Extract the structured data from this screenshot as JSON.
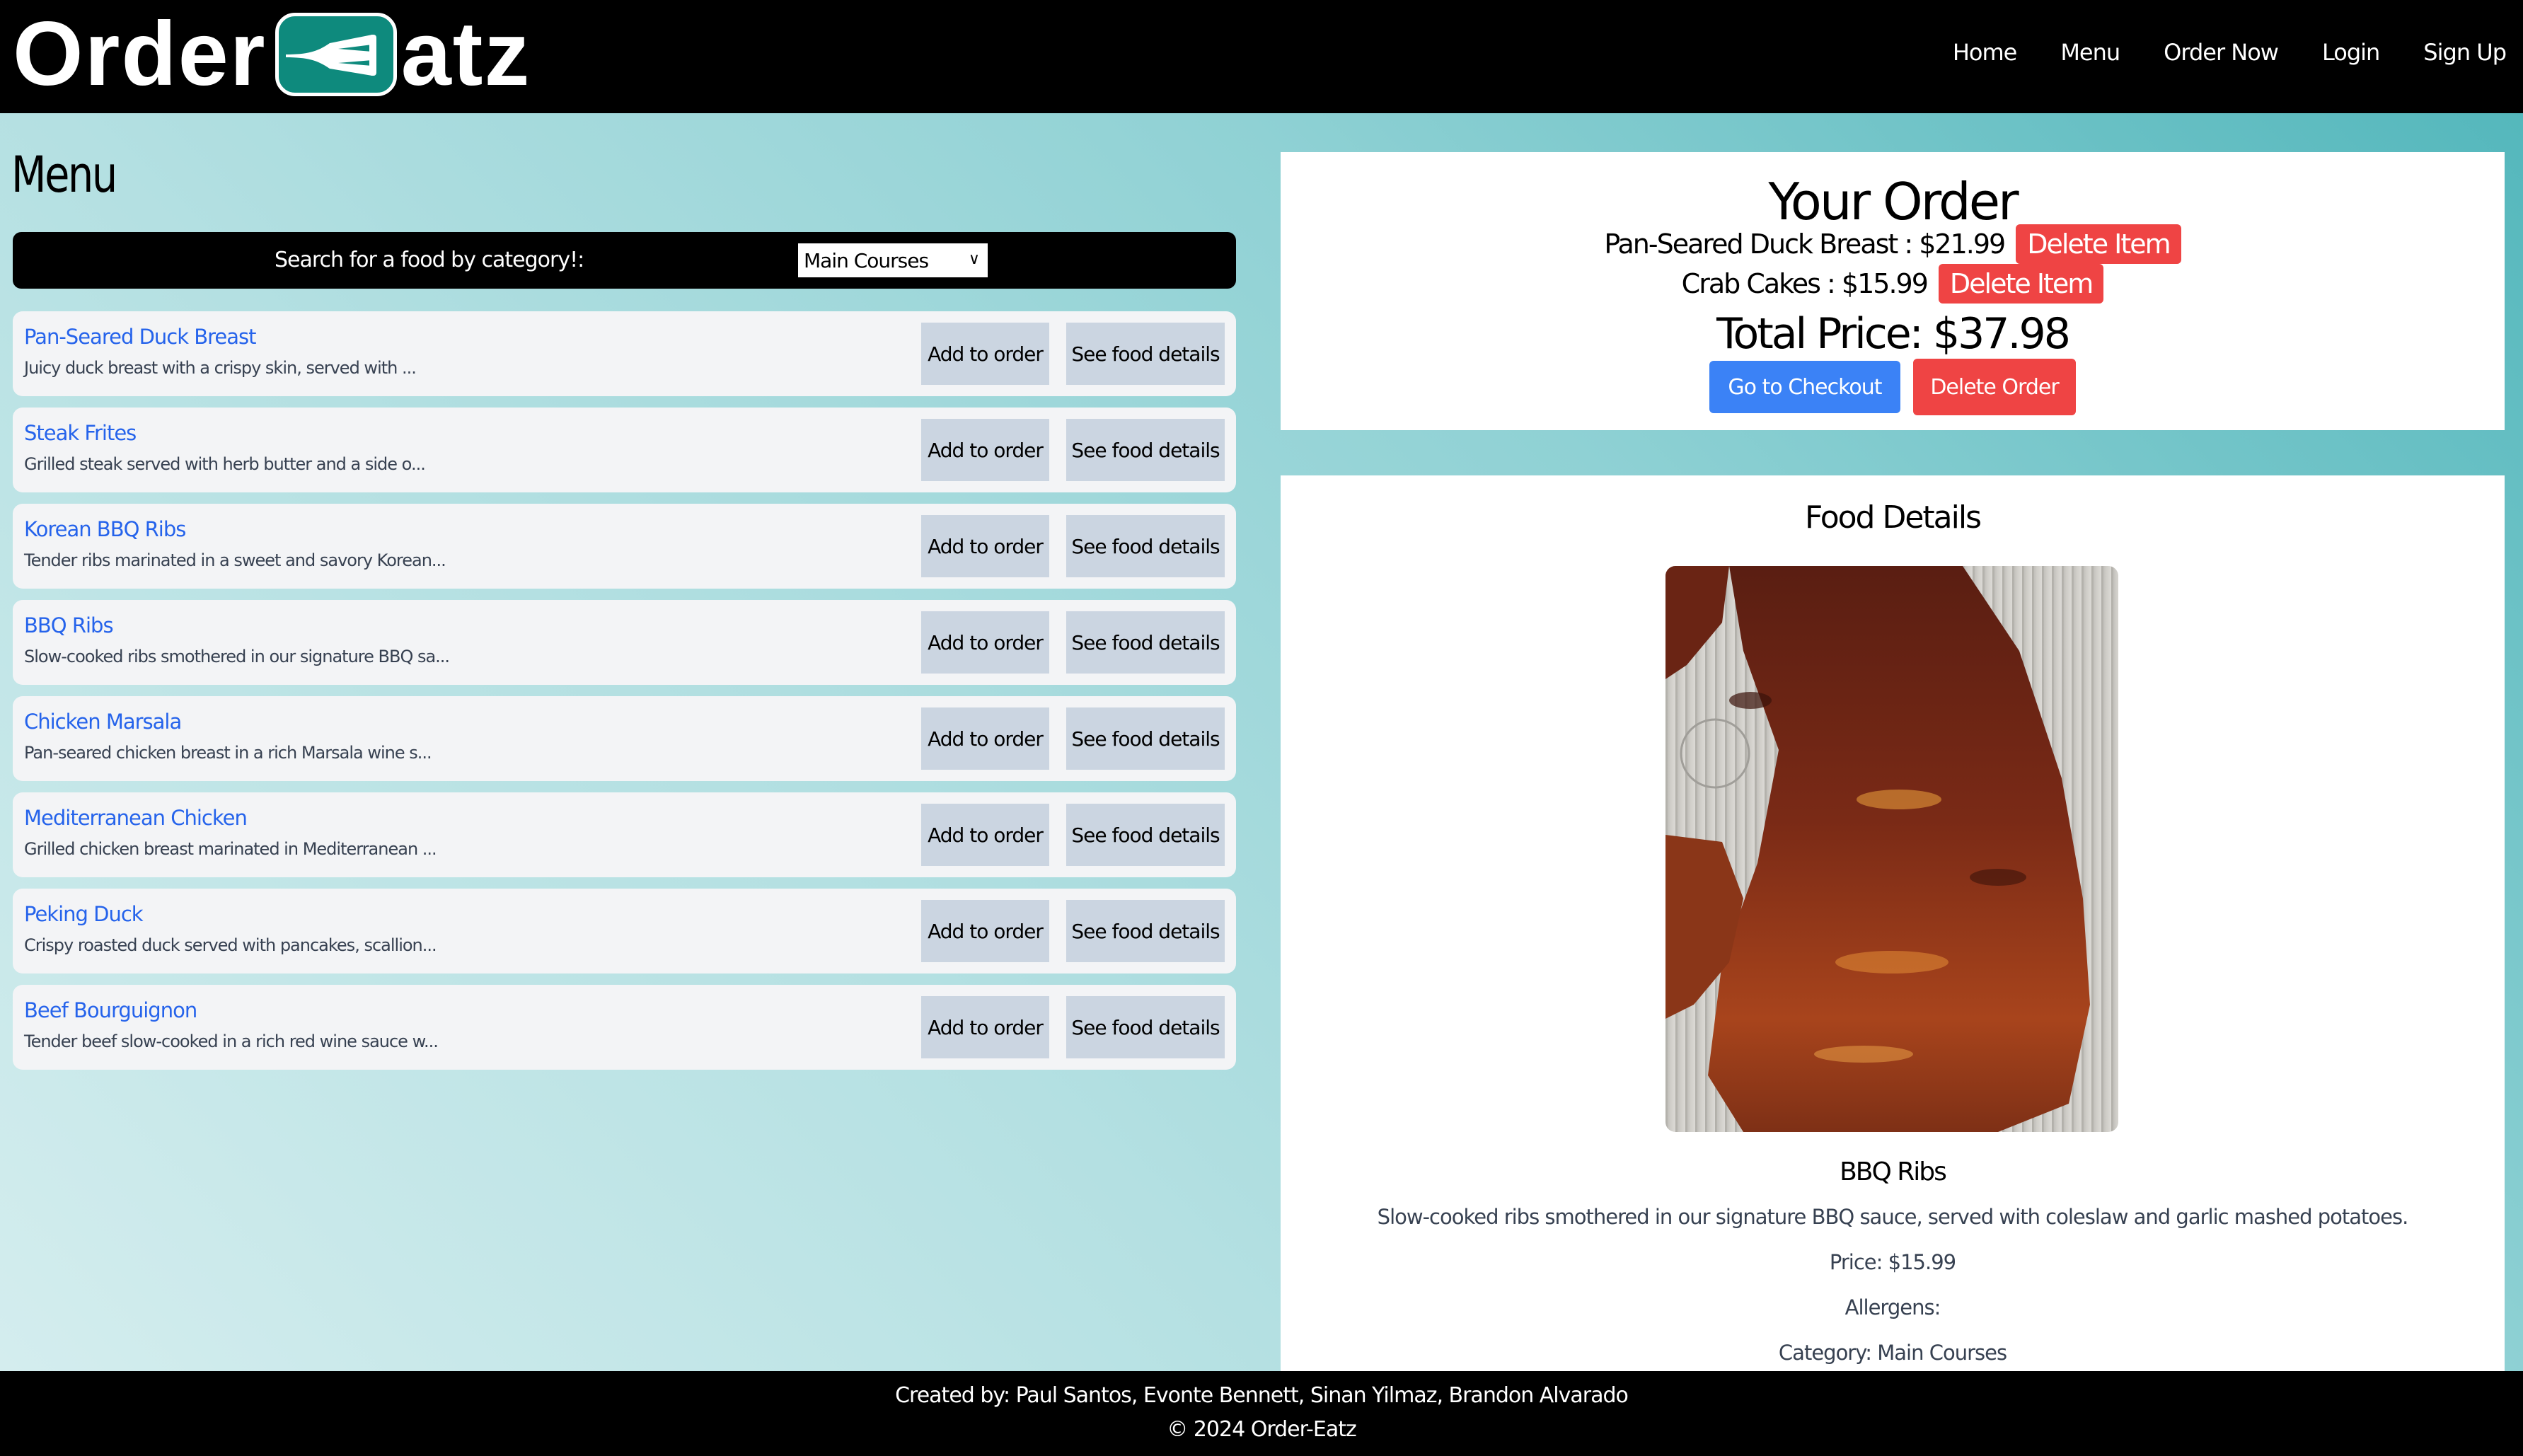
{
  "header": {
    "logo": {
      "left_text": "Order",
      "right_text": "atz",
      "badge_icon": "fork-e-icon",
      "badge_color": "#0e8a7d"
    },
    "nav": [
      {
        "label": "Home"
      },
      {
        "label": "Menu"
      },
      {
        "label": "Order Now"
      },
      {
        "label": "Login"
      },
      {
        "label": "Sign Up"
      }
    ]
  },
  "menu": {
    "title": "Menu",
    "search": {
      "label": "Search for a food by category!:",
      "selected": "Main Courses"
    },
    "add_label": "Add to order",
    "details_label": "See food details",
    "items": [
      {
        "name": "Pan-Seared Duck Breast",
        "desc": "Juicy duck breast with a crispy skin, served with ..."
      },
      {
        "name": "Steak Frites",
        "desc": "Grilled steak served with herb butter and a side o..."
      },
      {
        "name": "Korean BBQ Ribs",
        "desc": "Tender ribs marinated in a sweet and savory Korean..."
      },
      {
        "name": "BBQ Ribs",
        "desc": "Slow-cooked ribs smothered in our signature BBQ sa..."
      },
      {
        "name": "Chicken Marsala",
        "desc": "Pan-seared chicken breast in a rich Marsala wine s..."
      },
      {
        "name": "Mediterranean Chicken",
        "desc": "Grilled chicken breast marinated in Mediterranean ..."
      },
      {
        "name": "Peking Duck",
        "desc": "Crispy roasted duck served with pancakes, scallion..."
      },
      {
        "name": "Beef Bourguignon",
        "desc": "Tender beef slow-cooked in a rich red wine sauce w..."
      }
    ]
  },
  "order": {
    "title": "Your Order",
    "items": [
      {
        "text": "Pan-Seared Duck Breast : $21.99",
        "delete_label": "Delete Item"
      },
      {
        "text": "Crab Cakes : $15.99",
        "delete_label": "Delete Item"
      }
    ],
    "total": "Total Price: $37.98",
    "checkout_label": "Go to Checkout",
    "delete_order_label": "Delete Order"
  },
  "details": {
    "title": "Food Details",
    "image_alt": "BBQ Ribs photo",
    "name": "BBQ Ribs",
    "description": "Slow-cooked ribs smothered in our signature BBQ sauce, served with coleslaw and garlic mashed potatoes.",
    "price": "Price: $15.99",
    "allergens": "Allergens:",
    "category": "Category: Main Courses"
  },
  "footer": {
    "credits": "Created by: Paul Santos, Evonte Bennett, Sinan Yilmaz, Brandon Alvarado",
    "copyright": "© 2024 Order-Eatz"
  },
  "colors": {
    "link_blue": "#2563eb",
    "danger_red": "#ef4444",
    "primary_blue": "#3b82f6",
    "button_grey": "#cbd5e1",
    "card_bg": "#f3f4f6"
  }
}
